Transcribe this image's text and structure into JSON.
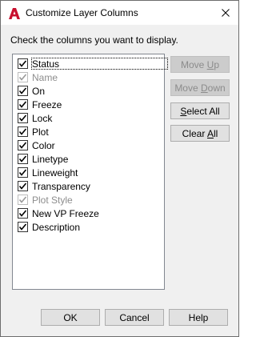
{
  "dialog": {
    "title": "Customize Layer Columns",
    "instruction": "Check the columns you want to display."
  },
  "columns": [
    {
      "label": "Status",
      "checked": true,
      "enabled": true
    },
    {
      "label": "Name",
      "checked": true,
      "enabled": false
    },
    {
      "label": "On",
      "checked": true,
      "enabled": true
    },
    {
      "label": "Freeze",
      "checked": true,
      "enabled": true
    },
    {
      "label": "Lock",
      "checked": true,
      "enabled": true
    },
    {
      "label": "Plot",
      "checked": true,
      "enabled": true
    },
    {
      "label": "Color",
      "checked": true,
      "enabled": true
    },
    {
      "label": "Linetype",
      "checked": true,
      "enabled": true
    },
    {
      "label": "Lineweight",
      "checked": true,
      "enabled": true
    },
    {
      "label": "Transparency",
      "checked": true,
      "enabled": true
    },
    {
      "label": "Plot Style",
      "checked": true,
      "enabled": false
    },
    {
      "label": "New VP Freeze",
      "checked": true,
      "enabled": true
    },
    {
      "label": "Description",
      "checked": true,
      "enabled": true
    }
  ],
  "side_buttons": {
    "move_up": {
      "pre": "Move ",
      "key": "U",
      "post": "p",
      "enabled": false
    },
    "move_down": {
      "pre": "Move ",
      "key": "D",
      "post": "own",
      "enabled": false
    },
    "select_all": {
      "pre": "",
      "key": "S",
      "post": "elect All",
      "enabled": true
    },
    "clear_all": {
      "pre": "Clear ",
      "key": "A",
      "post": "ll",
      "enabled": true
    }
  },
  "footer": {
    "ok": "OK",
    "cancel": "Cancel",
    "help": "Help"
  },
  "colors": {
    "app_icon": "#c8102e",
    "check_enabled": "#000000",
    "check_disabled": "#9a9a9a"
  },
  "icons": {
    "app": "autocad-a-icon",
    "close": "close-icon"
  }
}
